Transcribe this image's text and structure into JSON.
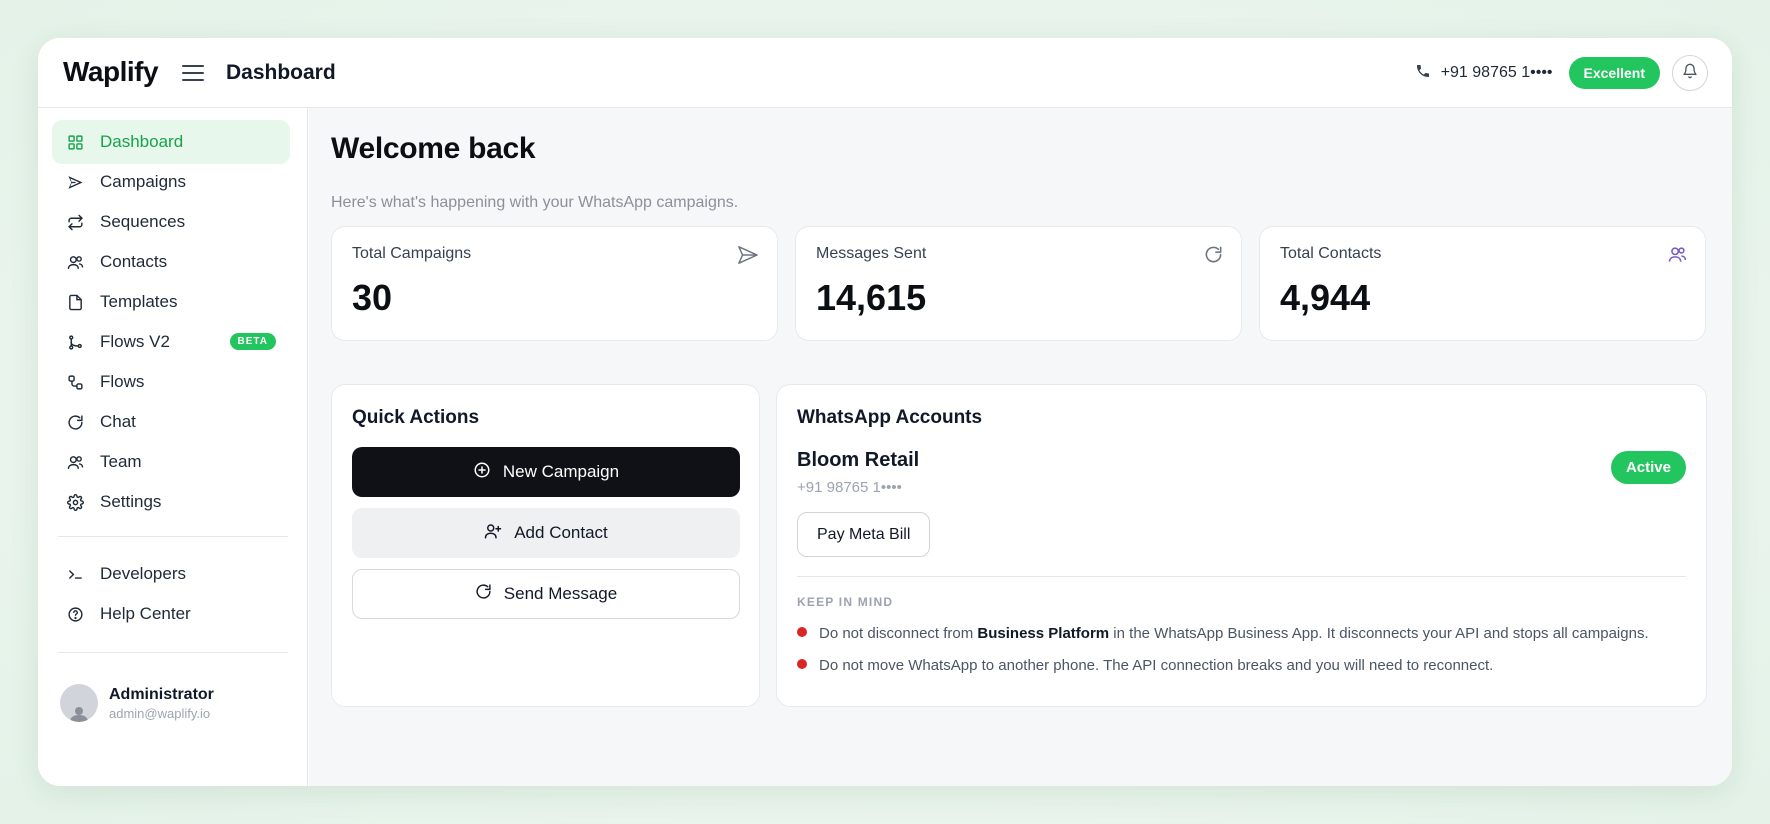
{
  "brand": "Waplify",
  "header": {
    "title": "Dashboard",
    "phone": "+91 98765 1••••",
    "quality": "Excellent"
  },
  "sidebar": {
    "items": [
      {
        "label": "Dashboard",
        "icon": "grid-icon",
        "active": true
      },
      {
        "label": "Campaigns",
        "icon": "send-icon"
      },
      {
        "label": "Sequences",
        "icon": "repeat-icon"
      },
      {
        "label": "Contacts",
        "icon": "users-icon"
      },
      {
        "label": "Templates",
        "icon": "file-icon"
      },
      {
        "label": "Flows V2",
        "icon": "git-branch-icon",
        "badge": "BETA"
      },
      {
        "label": "Flows",
        "icon": "workflow-icon"
      },
      {
        "label": "Chat",
        "icon": "refresh-icon"
      },
      {
        "label": "Team",
        "icon": "users-icon"
      },
      {
        "label": "Settings",
        "icon": "gear-icon"
      }
    ],
    "secondary": [
      {
        "label": "Developers",
        "icon": "terminal-icon"
      },
      {
        "label": "Help Center",
        "icon": "help-circle-icon"
      }
    ],
    "user": {
      "name": "Administrator",
      "email": "admin@waplify.io"
    }
  },
  "main": {
    "title": "Welcome back",
    "subtitle": "Here's what's happening with your WhatsApp campaigns.",
    "stats": [
      {
        "label": "Total Campaigns",
        "value": "30",
        "icon": "send-icon"
      },
      {
        "label": "Messages Sent",
        "value": "14,615",
        "icon": "refresh-icon"
      },
      {
        "label": "Total Contacts",
        "value": "4,944",
        "icon": "users-icon"
      }
    ],
    "quick_actions": {
      "title": "Quick Actions",
      "new_campaign": "New Campaign",
      "add_contact": "Add Contact",
      "send_message": "Send Message"
    },
    "accounts": {
      "title": "WhatsApp Accounts",
      "name": "Bloom Retail",
      "phone": "+91 98765 1••••",
      "status": "Active",
      "pay_button": "Pay Meta Bill",
      "keep_in_mind": "KEEP IN MIND",
      "note1_pre": "Do not disconnect from ",
      "note1_bold": "Business Platform",
      "note1_post": " in the WhatsApp Business App. It disconnects your API and stops all campaigns.",
      "note2": "Do not move WhatsApp to another phone. The API connection breaks and you will need to reconnect."
    }
  },
  "colors": {
    "accent": "#22c55e",
    "active_bg": "#e8f7ec",
    "dark": "#0f1116",
    "danger": "#dc2626",
    "contacts_icon": "#7c5cc4"
  }
}
